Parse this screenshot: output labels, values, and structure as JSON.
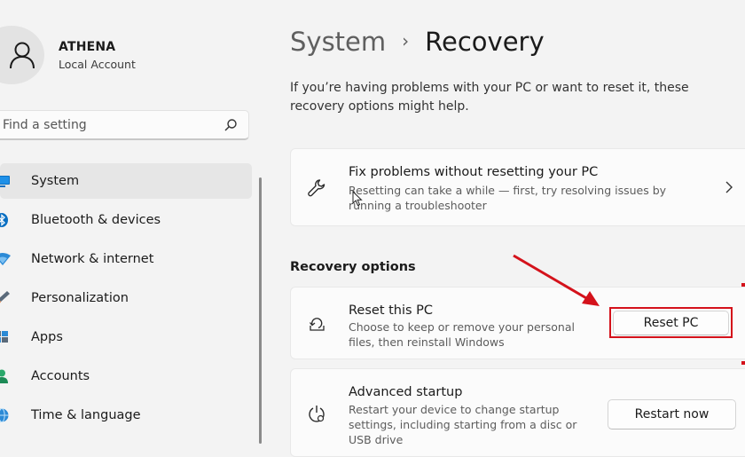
{
  "user": {
    "name": "ATHENA",
    "account_type": "Local Account"
  },
  "search": {
    "placeholder": "Find a setting",
    "icon": "search-icon"
  },
  "sidebar": {
    "items": [
      {
        "label": "System",
        "icon": "system-icon",
        "icon_color": "#0078d4",
        "active": true
      },
      {
        "label": "Bluetooth & devices",
        "icon": "bluetooth-icon",
        "icon_color": "#0078d4"
      },
      {
        "label": "Network & internet",
        "icon": "network-icon",
        "icon_color": "#2b8ad6"
      },
      {
        "label": "Personalization",
        "icon": "brush-icon",
        "icon_color": "#e8884a"
      },
      {
        "label": "Apps",
        "icon": "apps-icon",
        "icon_color": "#5a6a7a"
      },
      {
        "label": "Accounts",
        "icon": "accounts-icon",
        "icon_color": "#2aa86b"
      },
      {
        "label": "Time & language",
        "icon": "globe-icon",
        "icon_color": "#2b8ad6"
      }
    ]
  },
  "header": {
    "parent": "System",
    "separator": "›",
    "current": "Recovery"
  },
  "main": {
    "description": "If you’re having problems with your PC or want to reset it, these recovery options might help.",
    "fix_card": {
      "title": "Fix problems without resetting your PC",
      "subtitle": "Resetting can take a while — first, try resolving issues by running a troubleshooter",
      "icon": "wrench-icon"
    },
    "section_title": "Recovery options",
    "reset_card": {
      "title": "Reset this PC",
      "subtitle": "Choose to keep or remove your personal files, then reinstall Windows",
      "button": "Reset PC",
      "icon": "reset-icon"
    },
    "advanced_card": {
      "title": "Advanced startup",
      "subtitle": "Restart your device to change startup settings, including starting from a disc or USB drive",
      "button": "Restart now",
      "icon": "advanced-startup-icon"
    }
  },
  "annotation": {
    "color": "#d4121b"
  }
}
